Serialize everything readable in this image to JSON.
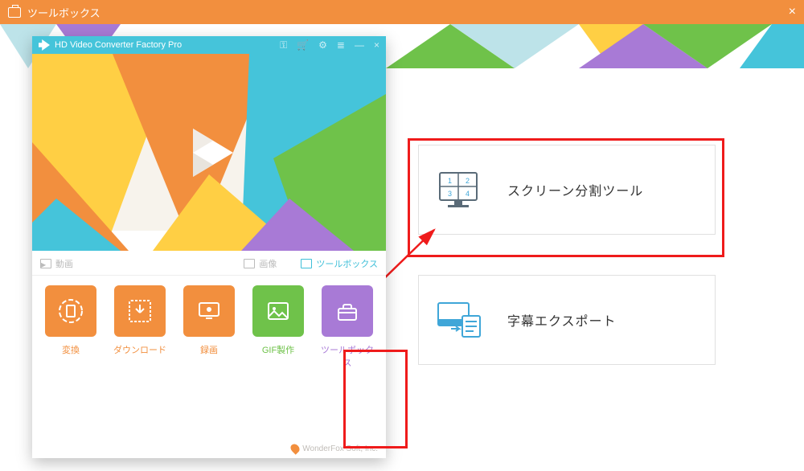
{
  "titlebar": {
    "title": "ツールボックス"
  },
  "app": {
    "title": "HD Video Converter Factory Pro",
    "tabs": {
      "video": "動画",
      "image": "画像",
      "toolbox": "ツールボックス"
    },
    "tiles": {
      "convert": "変換",
      "download": "ダウンロード",
      "record": "録画",
      "gif": "GIF製作",
      "toolbox": "ツールボックス"
    },
    "footer": "WonderFox Soft, Inc."
  },
  "tools": {
    "split": {
      "label": "スクリーン分割ツール",
      "grid": [
        "1",
        "2",
        "3",
        "4"
      ]
    },
    "subtitle": {
      "label": "字幕エクスポート"
    }
  },
  "colors": {
    "accent": "#f28f3e",
    "teal": "#45c4da",
    "green": "#6fc24a",
    "purple": "#a87ad6",
    "red": "#ef1b1b"
  }
}
